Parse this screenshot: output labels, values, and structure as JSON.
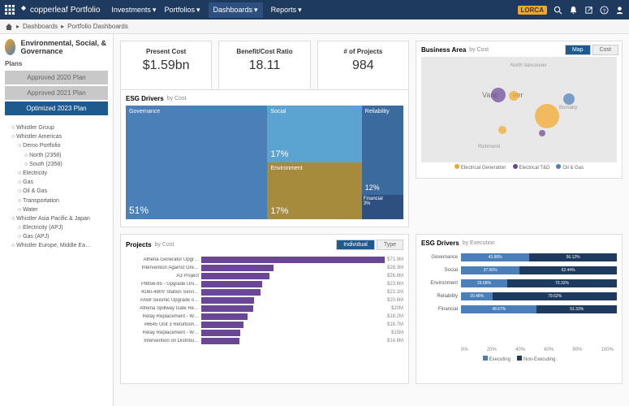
{
  "topbar": {
    "brand": "copperleaf",
    "product": "Portfolio",
    "nav": [
      "Investments",
      "Portfolios",
      "Dashboards",
      "Reports"
    ],
    "active": 2,
    "badge": "LORCA"
  },
  "breadcrumb": [
    "Dashboards",
    "Portfolio Dashboards"
  ],
  "sidebar": {
    "title": "Environmental, Social, & Governance",
    "section": "Plans",
    "plans": [
      "Approved 2020 Plan",
      "Approved 2021 Plan",
      "Optimized 2023 Plan"
    ],
    "active_plan": 2,
    "tree": [
      {
        "t": "Whistler Group",
        "l": 0
      },
      {
        "t": "Whistler Americas",
        "l": 1
      },
      {
        "t": "Demo Portfolio",
        "l": 2
      },
      {
        "t": "North (2358)",
        "l": 3
      },
      {
        "t": "South (2358)",
        "l": 3
      },
      {
        "t": "Electricity",
        "l": 2
      },
      {
        "t": "Gas",
        "l": 2
      },
      {
        "t": "Oil & Gas",
        "l": 2
      },
      {
        "t": "Transportation",
        "l": 2
      },
      {
        "t": "Water",
        "l": 2
      },
      {
        "t": "Whistler Asia Pacific & Japan",
        "l": 1
      },
      {
        "t": "Electricity (APJ)",
        "l": 2
      },
      {
        "t": "Gas (APJ)",
        "l": 2
      },
      {
        "t": "Whistler Europe, Middle Ea…",
        "l": 1
      }
    ]
  },
  "kpis": [
    {
      "label": "Present Cost",
      "value": "$1.59bn"
    },
    {
      "label": "Benefit/Cost Ratio",
      "value": "18.11"
    },
    {
      "label": "# of Projects",
      "value": "984"
    }
  ],
  "chart_data": [
    {
      "type": "treemap",
      "title": "ESG Drivers",
      "subtitle": "by Cost",
      "items": [
        {
          "name": "Governance",
          "value": 51,
          "color": "#4a7fb8"
        },
        {
          "name": "Social",
          "value": 17,
          "color": "#5ba3d0"
        },
        {
          "name": "Environment",
          "value": 17,
          "color": "#a68b3c"
        },
        {
          "name": "Reliability",
          "value": 12,
          "color": "#3a6a9e"
        },
        {
          "name": "Financial",
          "value": 3,
          "color": "#2d5080"
        }
      ]
    },
    {
      "type": "bubble-map",
      "title": "Business Area",
      "subtitle": "by Cost",
      "buttons": [
        "Map",
        "Cost"
      ],
      "city": "Vancouver",
      "legend": [
        {
          "name": "Electrical Generation",
          "color": "#f5a623"
        },
        {
          "name": "Electrical T&D",
          "color": "#6b4696"
        },
        {
          "name": "Oil & Gas",
          "color": "#4a7fb8"
        }
      ],
      "labels": [
        "North Vancouver",
        "Vancouver",
        "Burnaby",
        "Richmond"
      ]
    },
    {
      "type": "bar",
      "title": "Projects",
      "subtitle": "by Cost",
      "buttons": [
        "Individual",
        "Type"
      ],
      "categories": [
        "Athena Generator Upgr…",
        "Intervention Against Ore…",
        "A3 Project",
        "P8856-85 - Upgrade Uni…",
        "4160-480V Station Servi…",
        "#A58 Seismic Upgrade o…",
        "Athena Spillway Gate Re…",
        "Relay Replacement - W…",
        "#6645 Unit 3 Refurbish…",
        "Relay Replacement - W…",
        "Intervention on Distribu…"
      ],
      "values": [
        71.9,
        28.3,
        26.8,
        23.8,
        23.1,
        20.6,
        20.0,
        18.2,
        16.7,
        15.0,
        14.8
      ],
      "unit": "M",
      "ylabel": "",
      "xlabel": ""
    },
    {
      "type": "bar-stacked",
      "title": "ESG Drivers",
      "subtitle": "by Execution",
      "categories": [
        "Governance",
        "Social",
        "Environment",
        "Reliability",
        "Financial"
      ],
      "series": [
        {
          "name": "Executing",
          "values": [
            43.88,
            37.56,
            29.68,
            20.48,
            48.67
          ],
          "color": "#4a7fb8"
        },
        {
          "name": "Non-Executing",
          "values": [
            56.12,
            62.44,
            70.32,
            79.52,
            51.33
          ],
          "color": "#1e3a5f"
        }
      ],
      "xlim": [
        0,
        100
      ],
      "xticks": [
        0,
        20,
        40,
        60,
        80,
        100
      ],
      "xsuffix": "%"
    }
  ]
}
